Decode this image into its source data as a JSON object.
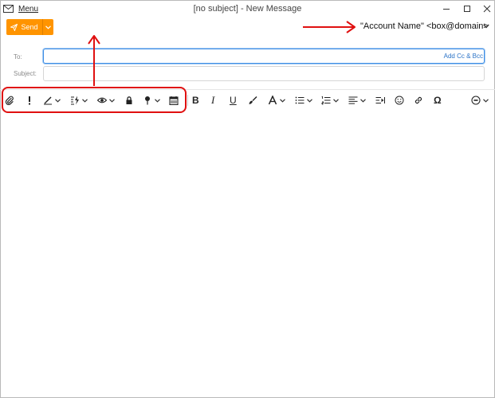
{
  "window": {
    "menu_label": "Menu",
    "title": "[no subject] - New Message",
    "controls": [
      "minimize-icon",
      "maximize-icon",
      "close-icon"
    ]
  },
  "send": {
    "label": "Send",
    "icon": "paper-plane-icon",
    "color": "#ff9400"
  },
  "from": {
    "account": "\"Account Name\" <box@domain>"
  },
  "headers": {
    "to_label": "To:",
    "add_cc_bcc": "Add Cc & Bcc",
    "subject_label": "Subject:"
  },
  "toolbar": {
    "left_group": [
      "paperclip-icon",
      "priority-icon",
      "signature-pen-icon",
      "format-lightning-icon",
      "eye-icon",
      "lock-icon",
      "pushpin-icon",
      "calendar-icon"
    ],
    "bold": "B",
    "italic": "I",
    "underline": "U",
    "special_char": "Ω",
    "right_group": [
      "brush-icon",
      "font-color-icon",
      "bullet-list-icon",
      "numbered-list-icon",
      "align-icon",
      "indent-icon",
      "emoji-icon",
      "link-icon",
      "more-icon"
    ]
  },
  "annotation": {
    "color": "#e01010"
  }
}
